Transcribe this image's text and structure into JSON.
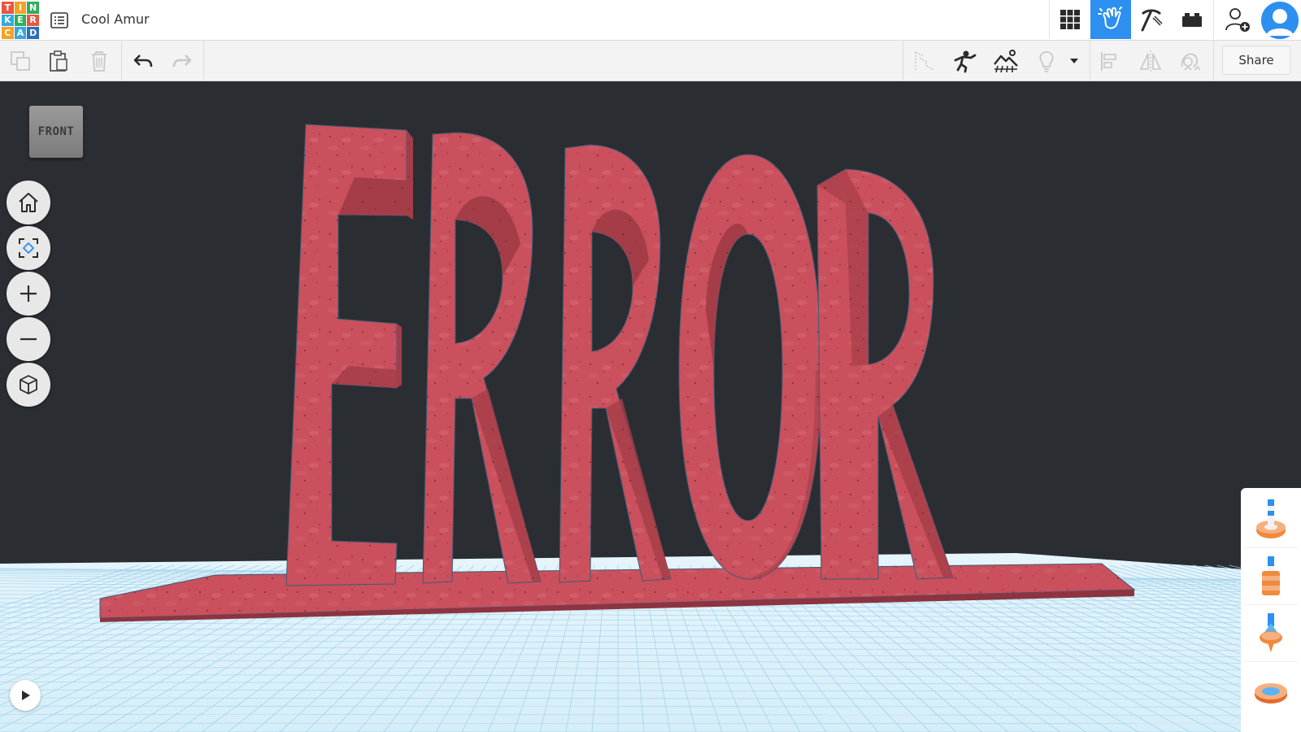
{
  "app": {
    "logo_letters": [
      "T",
      "I",
      "N",
      "K",
      "E",
      "R",
      "C",
      "A",
      "D"
    ],
    "logo_colors": [
      "#e8573f",
      "#f4a124",
      "#2eaf5a",
      "#35a8e0",
      "#2eaf5a",
      "#e8573f",
      "#f4a124",
      "#35a8e0",
      "#2b6fb8"
    ],
    "design_title": "Cool Amur"
  },
  "header": {
    "buttons": [
      {
        "name": "3d-design-view",
        "icon": "grid-icon"
      },
      {
        "name": "blocks-view",
        "icon": "hand-wave-icon",
        "active": true
      },
      {
        "name": "bricks-view",
        "icon": "pickaxe-icon"
      },
      {
        "name": "lego-view",
        "icon": "brick-icon"
      },
      {
        "name": "invite-user",
        "icon": "add-user-icon"
      },
      {
        "name": "user-avatar",
        "icon": "avatar-icon"
      }
    ],
    "accent_color": "#2d8ff0"
  },
  "toolbar": {
    "left_tools": [
      "copy-icon",
      "paste-icon",
      "delete-icon",
      "undo-icon",
      "redo-icon"
    ],
    "right_tools": [
      "note-icon",
      "show-all-icon",
      "workplane-icon",
      "light-icon",
      "dropdown-icon",
      "align-icon",
      "mirror-icon",
      "group-icon"
    ],
    "share_label": "Share"
  },
  "viewport": {
    "viewcube_label": "FRONT",
    "scene_text": "ERROR",
    "object_color": "#c44b58",
    "grid_color": "#d3eefa",
    "background_color": "#2a2e33"
  },
  "nav_controls": [
    "home-icon",
    "fit-view-icon",
    "zoom-in-icon",
    "zoom-out-icon",
    "perspective-icon"
  ],
  "shape_panel": {
    "items": [
      "shape-ring-with-pin",
      "shape-cylinder-stack",
      "shape-spinner",
      "shape-ring"
    ]
  }
}
